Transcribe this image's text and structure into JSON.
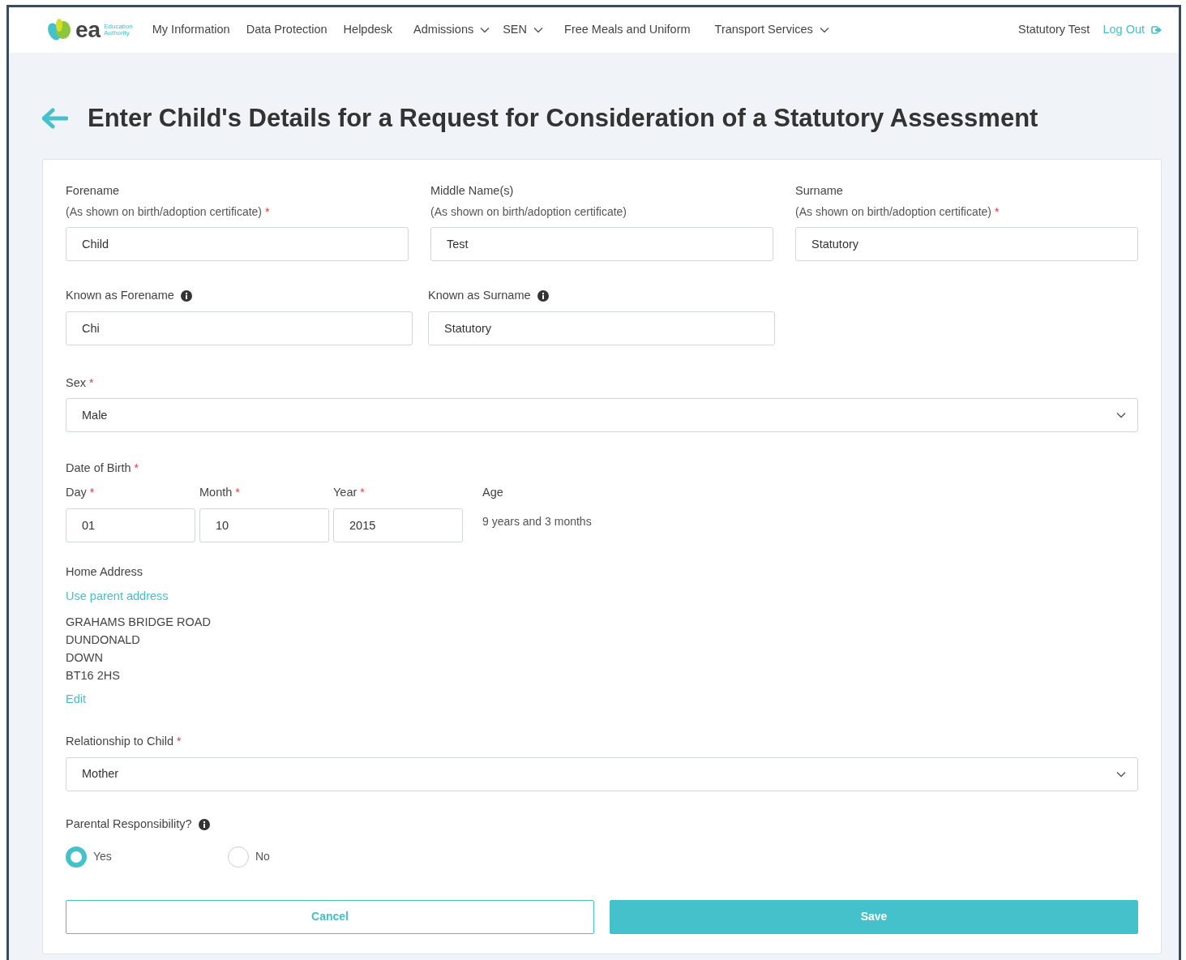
{
  "header": {
    "logo": {
      "mark": "ea",
      "caption": [
        "Education",
        "Authority"
      ]
    },
    "nav": [
      {
        "label": "My Information",
        "dropdown": false
      },
      {
        "label": "Data Protection",
        "dropdown": false
      },
      {
        "label": "Helpdesk",
        "dropdown": false
      },
      {
        "label": "Admissions",
        "dropdown": true
      },
      {
        "label": "SEN",
        "dropdown": true
      },
      {
        "label": "Free Meals and Uniform",
        "dropdown": false
      },
      {
        "label": "Transport Services",
        "dropdown": true
      }
    ],
    "user": "Statutory Test",
    "logout": "Log Out"
  },
  "title": "Enter Child's Details for a Request for Consideration of a Statutory Assessment",
  "form": {
    "name_fields": [
      {
        "label": "Forename",
        "hint": "(As shown on birth/adoption certificate)",
        "required_mark": "*",
        "value": "Child"
      },
      {
        "label": "Middle Name(s)",
        "hint": "(As shown on birth/adoption certificate)",
        "value": "Test"
      },
      {
        "label": "Surname",
        "hint": "(As shown on birth/adoption certificate)",
        "required_mark": "*",
        "value": "Statutory"
      }
    ],
    "known_as": [
      {
        "label": "Known as Forename",
        "value": "Chi"
      },
      {
        "label": "Known as Surname",
        "value": "Statutory"
      }
    ],
    "sex": {
      "label": "Sex",
      "required_mark": "*",
      "value": "Male"
    },
    "dob": {
      "label": "Date of Birth",
      "required_mark": "*",
      "parts": [
        {
          "label": "Day",
          "required_mark": "*",
          "value": "01"
        },
        {
          "label": "Month",
          "required_mark": "*",
          "value": "10"
        },
        {
          "label": "Year",
          "required_mark": "*",
          "value": "2015"
        }
      ],
      "age": {
        "label": "Age",
        "value": "9 years and 3 months"
      }
    },
    "address": {
      "label": "Home Address",
      "link": "Use parent address",
      "lines": [
        "GRAHAMS BRIDGE ROAD",
        "DUNDONALD",
        "DOWN",
        "BT16 2HS"
      ],
      "edit": "Edit"
    },
    "relationship": {
      "label": "Relationship to Child",
      "required_mark": "*",
      "value": "Mother"
    },
    "parental": {
      "label": "Parental Responsibility?",
      "options": [
        {
          "label": "Yes",
          "selected": true
        },
        {
          "label": "No",
          "selected": false
        }
      ]
    },
    "buttons": {
      "cancel": "Cancel",
      "save": "Save"
    }
  }
}
